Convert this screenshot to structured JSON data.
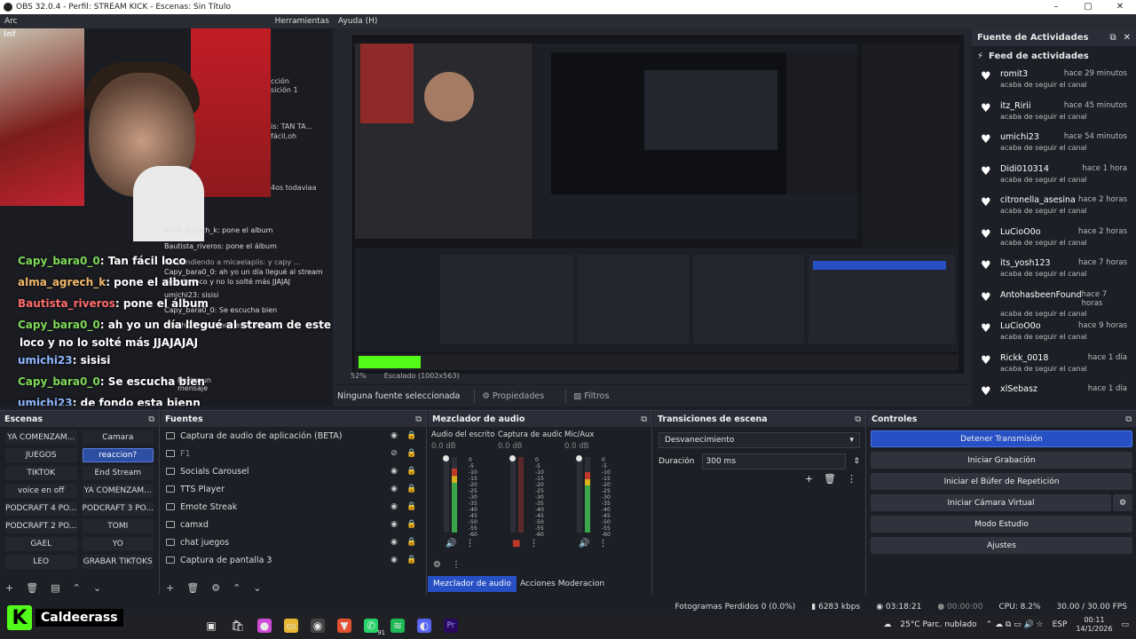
{
  "window": {
    "title": "OBS 32.0.4 - Perfil: STREAM KICK - Escenas: Sin Título",
    "controls": [
      "–",
      "▢",
      "✕"
    ]
  },
  "menu": {
    "items": [
      "Arc",
      "Herramientas",
      "Ayuda (H)"
    ]
  },
  "left_dock": {
    "title": "Inf"
  },
  "chat": {
    "lines": [
      {
        "user": "Capy_bara0_0",
        "msg": ": Tan fácil loco",
        "color": "u1"
      },
      {
        "user": "alma_agrech_k",
        "msg": ": pone el album",
        "color": "u2"
      },
      {
        "user": "Bautista_riveros",
        "msg": ": pone el álbum",
        "color": "u3"
      },
      {
        "user": "Capy_bara0_0",
        "msg": ": ah yo un día llegué al stream de este",
        "color": "u1"
      },
      {
        "user": "",
        "msg": "loco y no lo solté más JJAJAJAJ",
        "color": "u1"
      },
      {
        "user": "umichi23",
        "msg": ": sisisi",
        "color": "u4"
      },
      {
        "user": "Capy_bara0_0",
        "msg": ": Se escucha bien",
        "color": "u1"
      },
      {
        "user": "umichi23",
        "msg": ": de fondo esta bienn",
        "color": "u4"
      }
    ],
    "inner_dock_text": [
      "alma_agrech_k: pone el album",
      "Bautista_riveros: pone el álbum",
      "Respondiendo a micaelaplis: y capy ...",
      "Capy_bara0_0: ah yo un día llegué al stream de este loco y no lo solté más JJAJAJ",
      "umichi23: sisisi",
      "Capy_bara0_0: Se escucha bien",
      "umichi23: de fondo esta bienn"
    ],
    "send_placeholder": "Enviar un mensaje",
    "overlay_text": [
      "cción",
      "sición 1",
      "is: TAN TA...",
      "fácil,oh",
      "4os todaviaa"
    ]
  },
  "preview": {
    "zoom": "52%",
    "scaling": "Escalado (1002x563)",
    "no_source": "Ninguna fuente seleccionada",
    "properties": "Propiedades",
    "filters": "Filtros"
  },
  "feed": {
    "dock_title": "Fuente de Actividades",
    "header": "Feed de actividades",
    "items": [
      {
        "name": "romit3",
        "time": "hace 29 minutos",
        "sub": "acaba de seguir el canal"
      },
      {
        "name": "itz_Ririi",
        "time": "hace 45 minutos",
        "sub": "acaba de seguir el canal"
      },
      {
        "name": "umichi23",
        "time": "hace 54 minutos",
        "sub": "acaba de seguir el canal"
      },
      {
        "name": "Didi010314",
        "time": "hace 1 hora",
        "sub": "acaba de seguir el canal"
      },
      {
        "name": "citronella_asesina",
        "time": "hace 2 horas",
        "sub": "acaba de seguir el canal"
      },
      {
        "name": "LuCioO0o",
        "time": "hace 2 horas",
        "sub": "acaba de seguir el canal"
      },
      {
        "name": "its_yosh123",
        "time": "hace 7 horas",
        "sub": "acaba de seguir el canal"
      },
      {
        "name": "AntohasbeenFound",
        "time": "hace 7 horas",
        "sub": "acaba de seguir el canal"
      },
      {
        "name": "LuCioO0o",
        "time": "hace 9 horas",
        "sub": "acaba de seguir el canal"
      },
      {
        "name": "Rickk_0018",
        "time": "hace 1 día",
        "sub": "acaba de seguir el canal"
      },
      {
        "name": "xlSebasz",
        "time": "hace 1 día",
        "sub": ""
      }
    ]
  },
  "scenes": {
    "title": "Escenas",
    "items": [
      "YA COMENZAM...",
      "Camara",
      "JUEGOS",
      "reaccion?",
      "TIKTOK",
      "End Stream",
      "voice en off",
      "YA COMENZAM...",
      "PODCRAFT 4 PO...",
      "PODCRAFT 3 PO...",
      "PODCRAFT 2 PO...",
      "TOMI",
      "GAEL",
      "YO",
      "LEO",
      "GRABAR TIKTOKS"
    ],
    "active_index": 3
  },
  "sources": {
    "title": "Fuentes",
    "items": [
      {
        "name": "Captura de audio de aplicación (BETA)",
        "dim": false
      },
      {
        "name": "F1",
        "dim": true
      },
      {
        "name": "Socials Carousel",
        "dim": false
      },
      {
        "name": "TTS Player",
        "dim": false
      },
      {
        "name": "Emote Streak",
        "dim": false
      },
      {
        "name": "camxd",
        "dim": false
      },
      {
        "name": "chat juegos",
        "dim": false
      },
      {
        "name": "Captura de pantalla 3",
        "dim": false
      }
    ]
  },
  "mixer": {
    "title": "Mezclador de audio",
    "channels": [
      {
        "name": "Audio del escritorio",
        "db": "0.0 dB",
        "level": 0.85,
        "muted": false
      },
      {
        "name": "Captura de audio c",
        "db": "0.0 dB",
        "level": 0.0,
        "muted": true
      },
      {
        "name": "Mic/Aux",
        "db": "0.0 dB",
        "level": 0.8,
        "muted": false
      }
    ],
    "scale": [
      "0",
      "-5",
      "-10",
      "-15",
      "-20",
      "-25",
      "-30",
      "-35",
      "-40",
      "-45",
      "-50",
      "-55",
      "-60"
    ],
    "tab_active": "Mezclador de audio",
    "tab_other": "Acciones Moderacion"
  },
  "transitions": {
    "title": "Transiciones de escena",
    "type": "Desvanecimiento",
    "duration_label": "Duración",
    "duration_value": "300 ms"
  },
  "controls": {
    "title": "Controles",
    "buttons": [
      "Detener Transmisión",
      "Iniciar Grabación",
      "Iniciar el Búfer de Repetición",
      "Iniciar Cámara Virtual",
      "Modo Estudio",
      "Ajustes"
    ]
  },
  "status": {
    "frames": "Fotogramas Perdidos 0 (0.0%)",
    "bitrate": "6283 kbps",
    "stream_time": "03:18:21",
    "rec_time": "00:00:00",
    "cpu": "CPU: 8.2%",
    "fps": "30.00 / 30.00 FPS"
  },
  "brand": {
    "letter": "K",
    "name": "Caldeerass"
  },
  "taskbar": {
    "weather": "25°C  Parc. nublado",
    "lang": "ESP",
    "time": "00:11",
    "date": "14/1/2026",
    "badge": "91"
  },
  "colors": {
    "accent": "#2650c4",
    "kick_green": "#53fc18"
  }
}
